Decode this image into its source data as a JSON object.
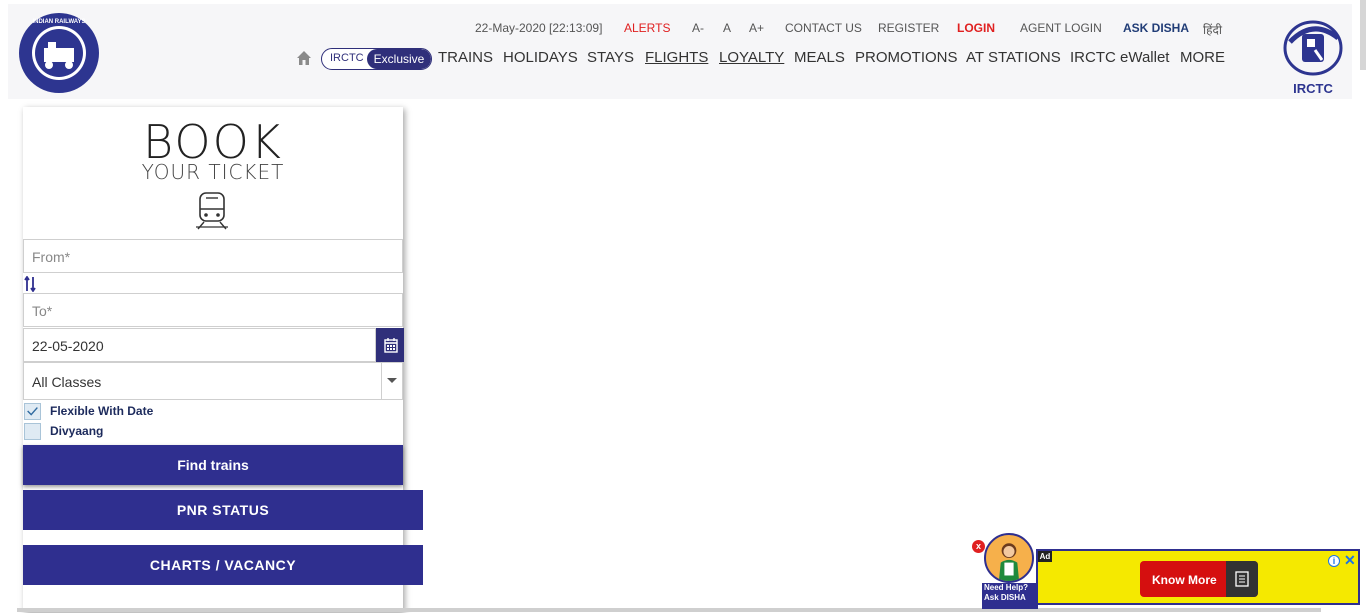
{
  "header": {
    "date_time": "22-May-2020 [22:13:09]",
    "alerts": "ALERTS",
    "font_minus": "A-",
    "font_normal": "A",
    "font_plus": "A+",
    "contact_us": "CONTACT US",
    "register": "REGISTER",
    "login": "LOGIN",
    "agent_login": "AGENT LOGIN",
    "ask_disha": "ASK DISHA",
    "hindi": "हिंदी",
    "logo_right_text": "IRCTC",
    "logo_left_text": "INDIAN RAILWAYS"
  },
  "nav": {
    "pill_left": "IRCTC",
    "pill_right": "Exclusive",
    "items": [
      "TRAINS",
      "HOLIDAYS",
      "STAYS",
      "FLIGHTS",
      "LOYALTY",
      "MEALS",
      "PROMOTIONS",
      "AT STATIONS",
      "IRCTC eWallet",
      "MORE"
    ]
  },
  "booking": {
    "title": "BOOK",
    "subtitle": "YOUR TICKET",
    "from_placeholder": "From*",
    "to_placeholder": "To*",
    "date_value": "22-05-2020",
    "class_value": "All Classes",
    "flexible_label": "Flexible With Date",
    "flexible_checked": true,
    "divyaang_label": "Divyaang",
    "divyaang_checked": false,
    "find_button": "Find trains"
  },
  "buttons": {
    "pnr_status": "PNR STATUS",
    "charts_vacancy": "CHARTS / VACANCY"
  },
  "disha_widget": {
    "line1": "Need Help?",
    "line2": "Ask DISHA"
  },
  "ad": {
    "tag": "Ad",
    "button_label": "Know More"
  },
  "colors": {
    "primary": "#2f2f8f",
    "alert_red": "#e02020",
    "ad_yellow": "#f5e900"
  }
}
